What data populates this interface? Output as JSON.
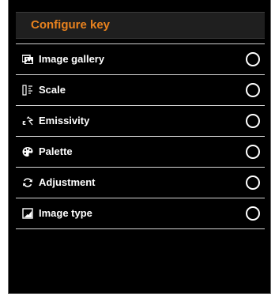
{
  "panel": {
    "title": "Configure key",
    "title_color": "#e8821e",
    "background_color": "#000000",
    "items": [
      {
        "label": "Image gallery",
        "icon": "image-gallery-icon",
        "selected": false
      },
      {
        "label": "Scale",
        "icon": "scale-icon",
        "selected": false
      },
      {
        "label": "Emissivity",
        "icon": "emissivity-icon",
        "selected": false
      },
      {
        "label": "Palette",
        "icon": "palette-icon",
        "selected": false
      },
      {
        "label": "Adjustment",
        "icon": "adjustment-icon",
        "selected": false
      },
      {
        "label": "Image type",
        "icon": "image-type-icon",
        "selected": false
      }
    ]
  }
}
